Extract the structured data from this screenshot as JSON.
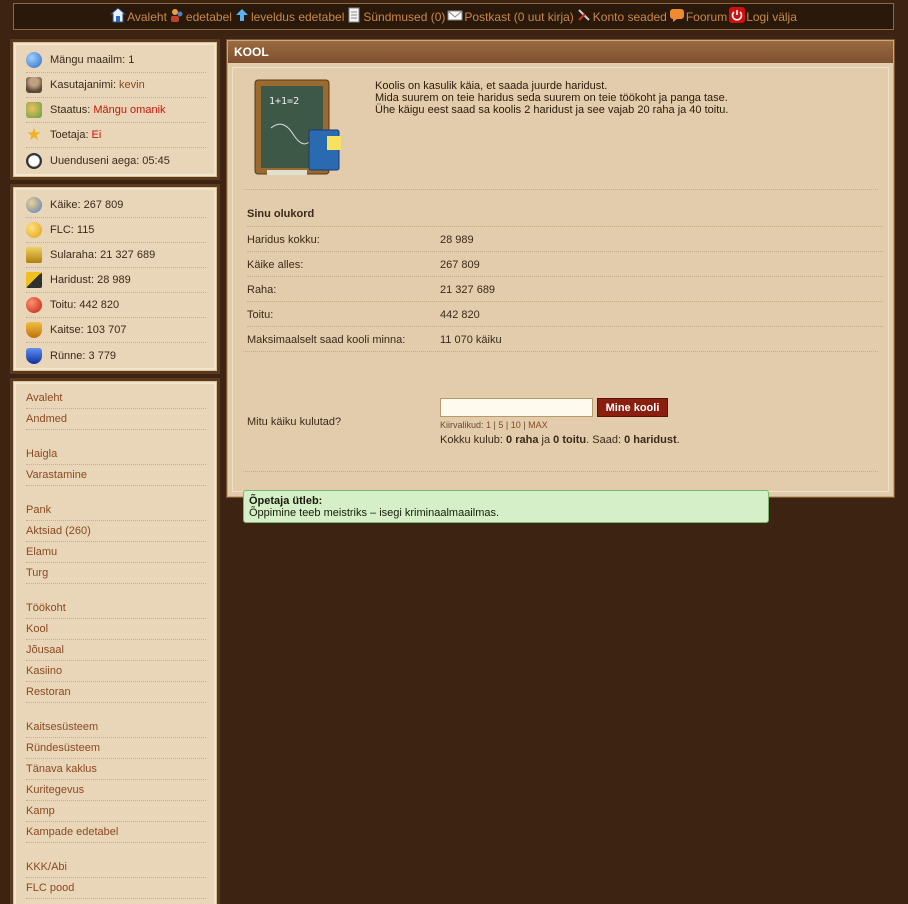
{
  "nav": [
    {
      "label": "Avaleht",
      "icon": "home-icon"
    },
    {
      "label": "edetabel",
      "icon": "users-icon"
    },
    {
      "label": "leveldus edetabel",
      "icon": "arrow-up-icon"
    },
    {
      "label": "Sündmused (0)",
      "icon": "document-icon"
    },
    {
      "label": "Postkast (0 uut kirja)",
      "icon": "envelope-icon"
    },
    {
      "label": "Konto seaded",
      "icon": "tools-icon"
    },
    {
      "label": "Foorum",
      "icon": "chat-icon"
    },
    {
      "label": "Logi välja",
      "icon": "power-icon"
    }
  ],
  "profile": {
    "world_label": "Mängu maailm:",
    "world_value": "1",
    "user_label": "Kasutajanimi:",
    "user_value": "kevin",
    "status_label": "Staatus:",
    "status_value": "Mängu omanik",
    "supporter_label": "Toetaja:",
    "supporter_value": "Ei",
    "refresh_label": "Uuenduseni aega:",
    "refresh_value": "05:45"
  },
  "stats": {
    "moves": "Käike: 267 809",
    "flc": "FLC: 115",
    "cash": "Sularaha: 21 327 689",
    "education": "Haridust: 28 989",
    "food": "Toitu: 442 820",
    "defense": "Kaitse: 103 707",
    "attack": "Rünne: 3 779"
  },
  "menu": {
    "g1": [
      "Avaleht",
      "Andmed"
    ],
    "g2": [
      "Haigla",
      "Varastamine"
    ],
    "g3": [
      "Pank",
      "Aktsiad (260)",
      "Elamu",
      "Turg"
    ],
    "g4": [
      "Töökoht",
      "Kool",
      "Jõusaal",
      "Kasiino",
      "Restoran"
    ],
    "g5": [
      "Kaitsesüsteem",
      "Ründesüsteem",
      "Tänava kaklus",
      "Kuritegevus",
      "Kamp",
      "Kampade edetabel"
    ],
    "g6": [
      "KKK/Abi",
      "FLC pood"
    ]
  },
  "main": {
    "title": "KOOL",
    "intro1": "Koolis on kasulik käia, et saada juurde haridust.",
    "intro2": "Mida suurem on teie haridus seda suurem on teie töökoht ja panga tase.",
    "intro3": "Ühe käigu eest saad sa koolis 2 haridust ja see vajab 20 raha ja 40 toitu.",
    "board_text": "1+1=2",
    "status_title": "Sinu olukord",
    "rows": [
      {
        "k": "Haridus kokku:",
        "v": "28 989"
      },
      {
        "k": "Käike alles:",
        "v": "267 809"
      },
      {
        "k": "Raha:",
        "v": "21 327 689"
      },
      {
        "k": "Toitu:",
        "v": "442 820"
      },
      {
        "k": "Maksimaalselt saad kooli minna:",
        "v": "11 070 käiku"
      }
    ],
    "form_label": "Mitu käiku kulutad?",
    "input_value": "",
    "button_label": "Mine kooli",
    "quick_label": "Kiirvalikud:",
    "quick": [
      "1",
      "5",
      "10",
      "MAX"
    ],
    "total_prefix": "Kokku kulub:",
    "total_money": "0 raha",
    "total_and": "ja",
    "total_food": "0 toitu",
    "total_get": ". Saad:",
    "total_edu": "0 haridust",
    "total_end": ".",
    "tip_title": "Õpetaja ütleb:",
    "tip_text": "Õppimine teeb meistriks – isegi kriminaalmaailmas."
  }
}
